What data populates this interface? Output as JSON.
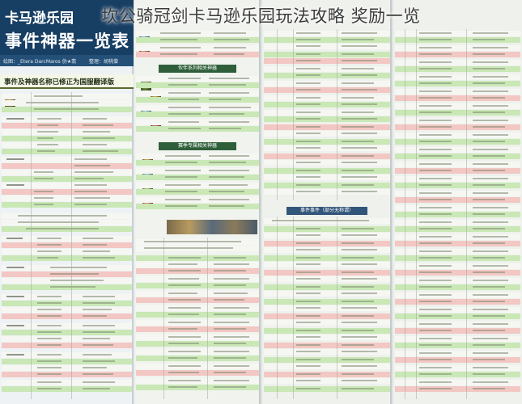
{
  "headline": "坎公骑冠剑卡马逊乐园玩法攻略 奖励一览",
  "poster": {
    "banner_line1": "卡马逊乐园",
    "banner_line2": "事件神器一览表",
    "credits": [
      "绘图：_Etera  DarcMaros  伪★翡",
      "整理：胡桃僧"
    ],
    "subtitle": "事件及神器名称已修正为国服翻译版",
    "section_labels": [
      "伙伴系列相关神器",
      "赛季专属相关神器",
      "事件事件（部分无称谓）"
    ]
  },
  "colors": {
    "banner": "#173e63",
    "green_row": "#c9e8b6",
    "pink_row": "#f3c7c3",
    "section_header": "#2f5f3a"
  }
}
